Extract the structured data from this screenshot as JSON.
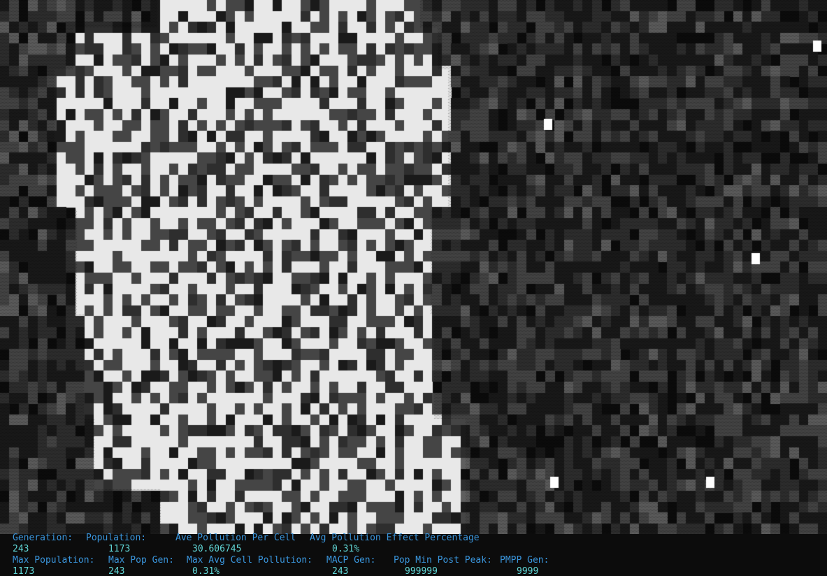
{
  "window": {
    "background": "#0c0c0c"
  },
  "simulation": {
    "cols": 88,
    "rows": 49,
    "live_color": "#e8e8e8",
    "dead_color": "#0c0c0c",
    "pollution_colors": [
      "#1a1a1a",
      "#2e2e2e",
      "#454545",
      "#5e5e5e"
    ],
    "highlight_color": "#ffffff"
  },
  "stats": {
    "row1_labels": {
      "generation": "Generation:",
      "population": "Population:",
      "ave_pollution": "Ave Pollution Per Cell",
      "avg_effect": "Avg Pollution Effect Percentage"
    },
    "row1_values": {
      "generation": "243",
      "population": "1173",
      "ave_pollution": "30.606745",
      "avg_effect": "0.31%"
    },
    "row2_labels": {
      "max_population": "Max Population:",
      "max_pop_gen": "Max Pop Gen:",
      "max_avg_cell_pollution": "Max Avg Cell Pollution:",
      "macp_gen": "MACP Gen:",
      "pop_min_post_peak": "Pop Min Post Peak:",
      "pmpp_gen": "PMPP Gen:"
    },
    "row2_values": {
      "max_population": "1173",
      "max_pop_gen": "243",
      "max_avg_cell_pollution": "0.31%",
      "macp_gen": "243",
      "pop_min_post_peak": "999999",
      "pmpp_gen": "9999"
    },
    "label_color": "#3a96dd",
    "value_color": "#61d6d6"
  }
}
